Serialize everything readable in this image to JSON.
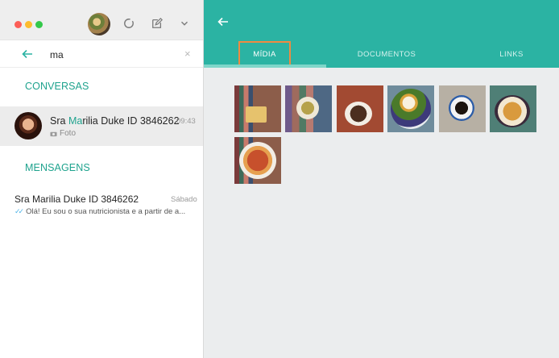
{
  "window": {
    "controls": [
      "close",
      "minimize",
      "zoom"
    ]
  },
  "left_header": {
    "avatar": "profile-avatar",
    "icons": [
      "status-icon",
      "new-chat-icon",
      "chevron-down-icon"
    ]
  },
  "search": {
    "value": "ma",
    "clear_glyph": "×"
  },
  "sections": {
    "conversations": "CONVERSAS",
    "messages": "MENSAGENS"
  },
  "conversation": {
    "name_prefix": "Sra ",
    "name_highlight": "Ma",
    "name_suffix": "rilia Duke ID 3846262",
    "time": "09:43",
    "subtitle": "Foto",
    "highlight_color": "#1fa38e"
  },
  "message": {
    "name": "Sra Marilia Duke ID 3846262",
    "day": "Sábado",
    "preview": "Olá! Eu sou o sua nutricionista e a partir de a..."
  },
  "right_header": {
    "color": "#2bb3a3",
    "tabs": [
      {
        "label": "MÍDIA",
        "active": true
      },
      {
        "label": "DOCUMENTOS",
        "active": false
      },
      {
        "label": "LINKS",
        "active": false
      }
    ]
  },
  "media_thumbnails": [
    {
      "name": "media-thumb-toast"
    },
    {
      "name": "media-thumb-soup"
    },
    {
      "name": "media-thumb-cake"
    },
    {
      "name": "media-thumb-plate"
    },
    {
      "name": "media-thumb-coffee"
    },
    {
      "name": "media-thumb-croissant"
    },
    {
      "name": "media-thumb-pasta"
    }
  ]
}
